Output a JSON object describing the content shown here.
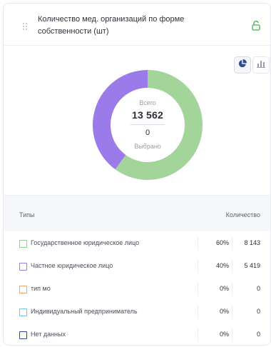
{
  "widget": {
    "title": "Количество мед. организаций по форме собственности (шт)"
  },
  "toggles": [
    {
      "icon": "pie-chart-icon",
      "active": true
    },
    {
      "icon": "bar-chart-icon",
      "active": false
    }
  ],
  "center": {
    "total_label": "Всего",
    "total": "13 562",
    "selected": "0",
    "selected_label": "Выбрано"
  },
  "table": {
    "col_types": "Типы",
    "col_count": "Количество",
    "rows": [
      {
        "name": "Государственное юридическое лицо",
        "pct": "60%",
        "count": "8 143",
        "color": "#8fd18f"
      },
      {
        "name": "Частное юридическое лицо",
        "pct": "40%",
        "count": "5 419",
        "color": "#9b7bea"
      },
      {
        "name": "тип мо",
        "pct": "0%",
        "count": "0",
        "color": "#f0a36a"
      },
      {
        "name": "Индивидуальный предприниматель",
        "pct": "0%",
        "count": "0",
        "color": "#78c2e8"
      },
      {
        "name": "Нет данных",
        "pct": "0%",
        "count": "0",
        "color": "#2c4a8a"
      }
    ]
  },
  "chart_data": {
    "type": "pie",
    "categories": [
      "Государственное юридическое лицо",
      "Частное юридическое лицо",
      "тип мо",
      "Индивидуальный предприниматель",
      "Нет данных"
    ],
    "values": [
      8143,
      5419,
      0,
      0,
      0
    ],
    "colors": [
      "#a3d49a",
      "#9b7bea",
      "#f0a36a",
      "#78c2e8",
      "#2c4a8a"
    ]
  }
}
